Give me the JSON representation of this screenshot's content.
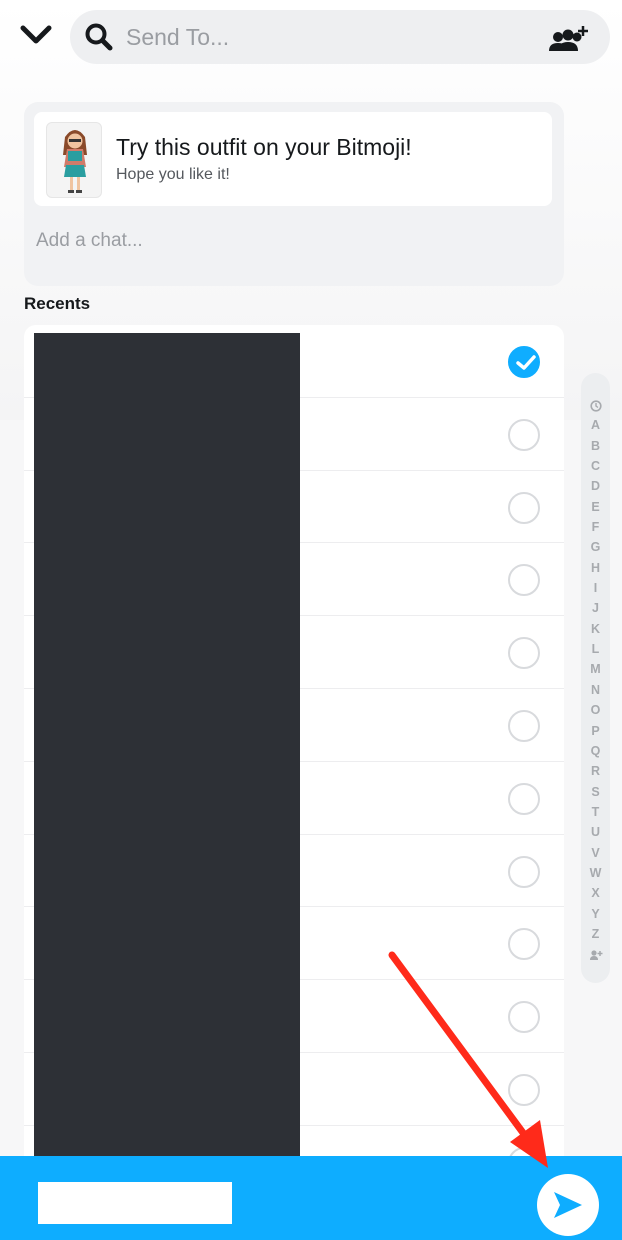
{
  "search": {
    "placeholder": "Send To...",
    "icon": "search-icon"
  },
  "header": {
    "back_icon": "chevron-down-icon",
    "add_friends_icon": "add-friends-icon"
  },
  "share_card": {
    "title": "Try this outfit on your Bitmoji!",
    "subtitle": "Hope you like it!",
    "chat_placeholder": "Add a chat..."
  },
  "recents": {
    "label": "Recents",
    "rows": [
      {
        "selected": true
      },
      {
        "selected": false
      },
      {
        "selected": false
      },
      {
        "selected": false
      },
      {
        "selected": false
      },
      {
        "selected": false
      },
      {
        "selected": false
      },
      {
        "selected": false
      },
      {
        "selected": false
      },
      {
        "selected": false
      },
      {
        "selected": false
      },
      {
        "selected": false
      }
    ]
  },
  "alpha_index": {
    "top_icon": "clock-icon",
    "letters": [
      "A",
      "B",
      "C",
      "D",
      "E",
      "F",
      "G",
      "H",
      "I",
      "J",
      "K",
      "L",
      "M",
      "N",
      "O",
      "P",
      "Q",
      "R",
      "S",
      "T",
      "U",
      "V",
      "W",
      "X",
      "Y",
      "Z"
    ],
    "bottom_icon": "add-friend-icon"
  },
  "bottom_bar": {
    "send_icon": "send-arrow-icon"
  },
  "colors": {
    "accent": "#0eadff",
    "annotation": "#ff2a1a",
    "redaction": "#2d3036"
  }
}
